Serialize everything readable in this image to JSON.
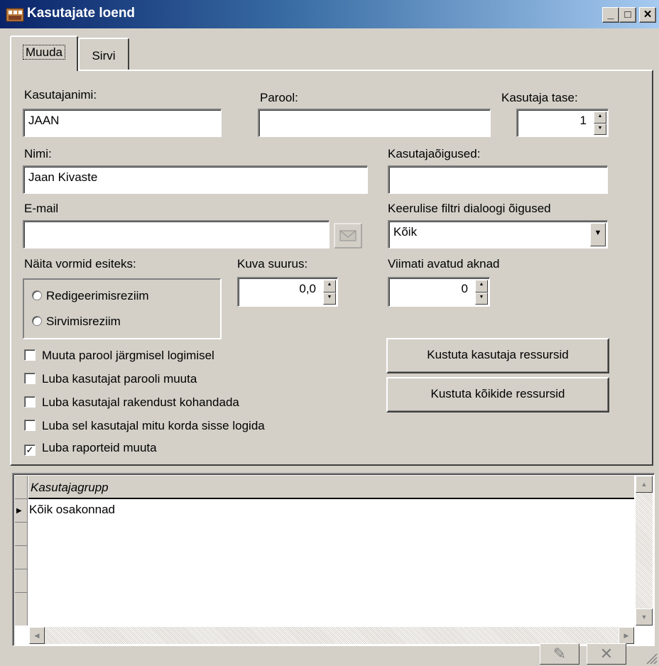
{
  "window": {
    "title": "Kasutajate loend",
    "minimize": "_",
    "maximize": "□",
    "close": "×"
  },
  "tabs": [
    {
      "label": "Muuda",
      "active": true
    },
    {
      "label": "Sirvi",
      "active": false
    }
  ],
  "form": {
    "username_label": "Kasutajanimi:",
    "username_value": "JAAN",
    "password_label": "Parool:",
    "password_value": "",
    "level_label": "Kasutaja tase:",
    "level_value": "1",
    "name_label": "Nimi:",
    "name_value": "Jaan Kivaste",
    "rights_label": "Kasutajaõigused:",
    "rights_value": "",
    "email_label": "E-mail",
    "email_value": "",
    "filter_rights_label": "Keerulise filtri dialoogi õigused",
    "filter_rights_value": "Kõik",
    "show_forms_label": "Näita vormid esiteks:",
    "radio_edit": "Redigeerimisreziim",
    "radio_browse": "Sirvimisreziim",
    "scale_label": "Kuva suurus:",
    "scale_value": "0,0",
    "recent_label": "Viimati avatud aknad",
    "recent_value": "0"
  },
  "checkboxes": [
    {
      "label": "Muuta parool järgmisel logimisel",
      "checked": false
    },
    {
      "label": "Luba kasutajat parooli muuta",
      "checked": false
    },
    {
      "label": "Luba kasutajal rakendust kohandada",
      "checked": false
    },
    {
      "label": "Luba sel kasutajal mitu korda sisse logida",
      "checked": false
    },
    {
      "label": "Luba raporteid muuta",
      "checked": true
    }
  ],
  "buttons": {
    "delete_user_resources": "Kustuta kasutaja ressursid",
    "delete_all_resources": "Kustuta kõikide ressursid"
  },
  "grid": {
    "column": "Kasutajagrupp",
    "rows": [
      "Kõik osakonnad"
    ]
  },
  "icons": {
    "email": "envelope-icon",
    "app": "app-icon",
    "nav_post": "post-icon",
    "nav_cancel": "cancel-icon"
  }
}
